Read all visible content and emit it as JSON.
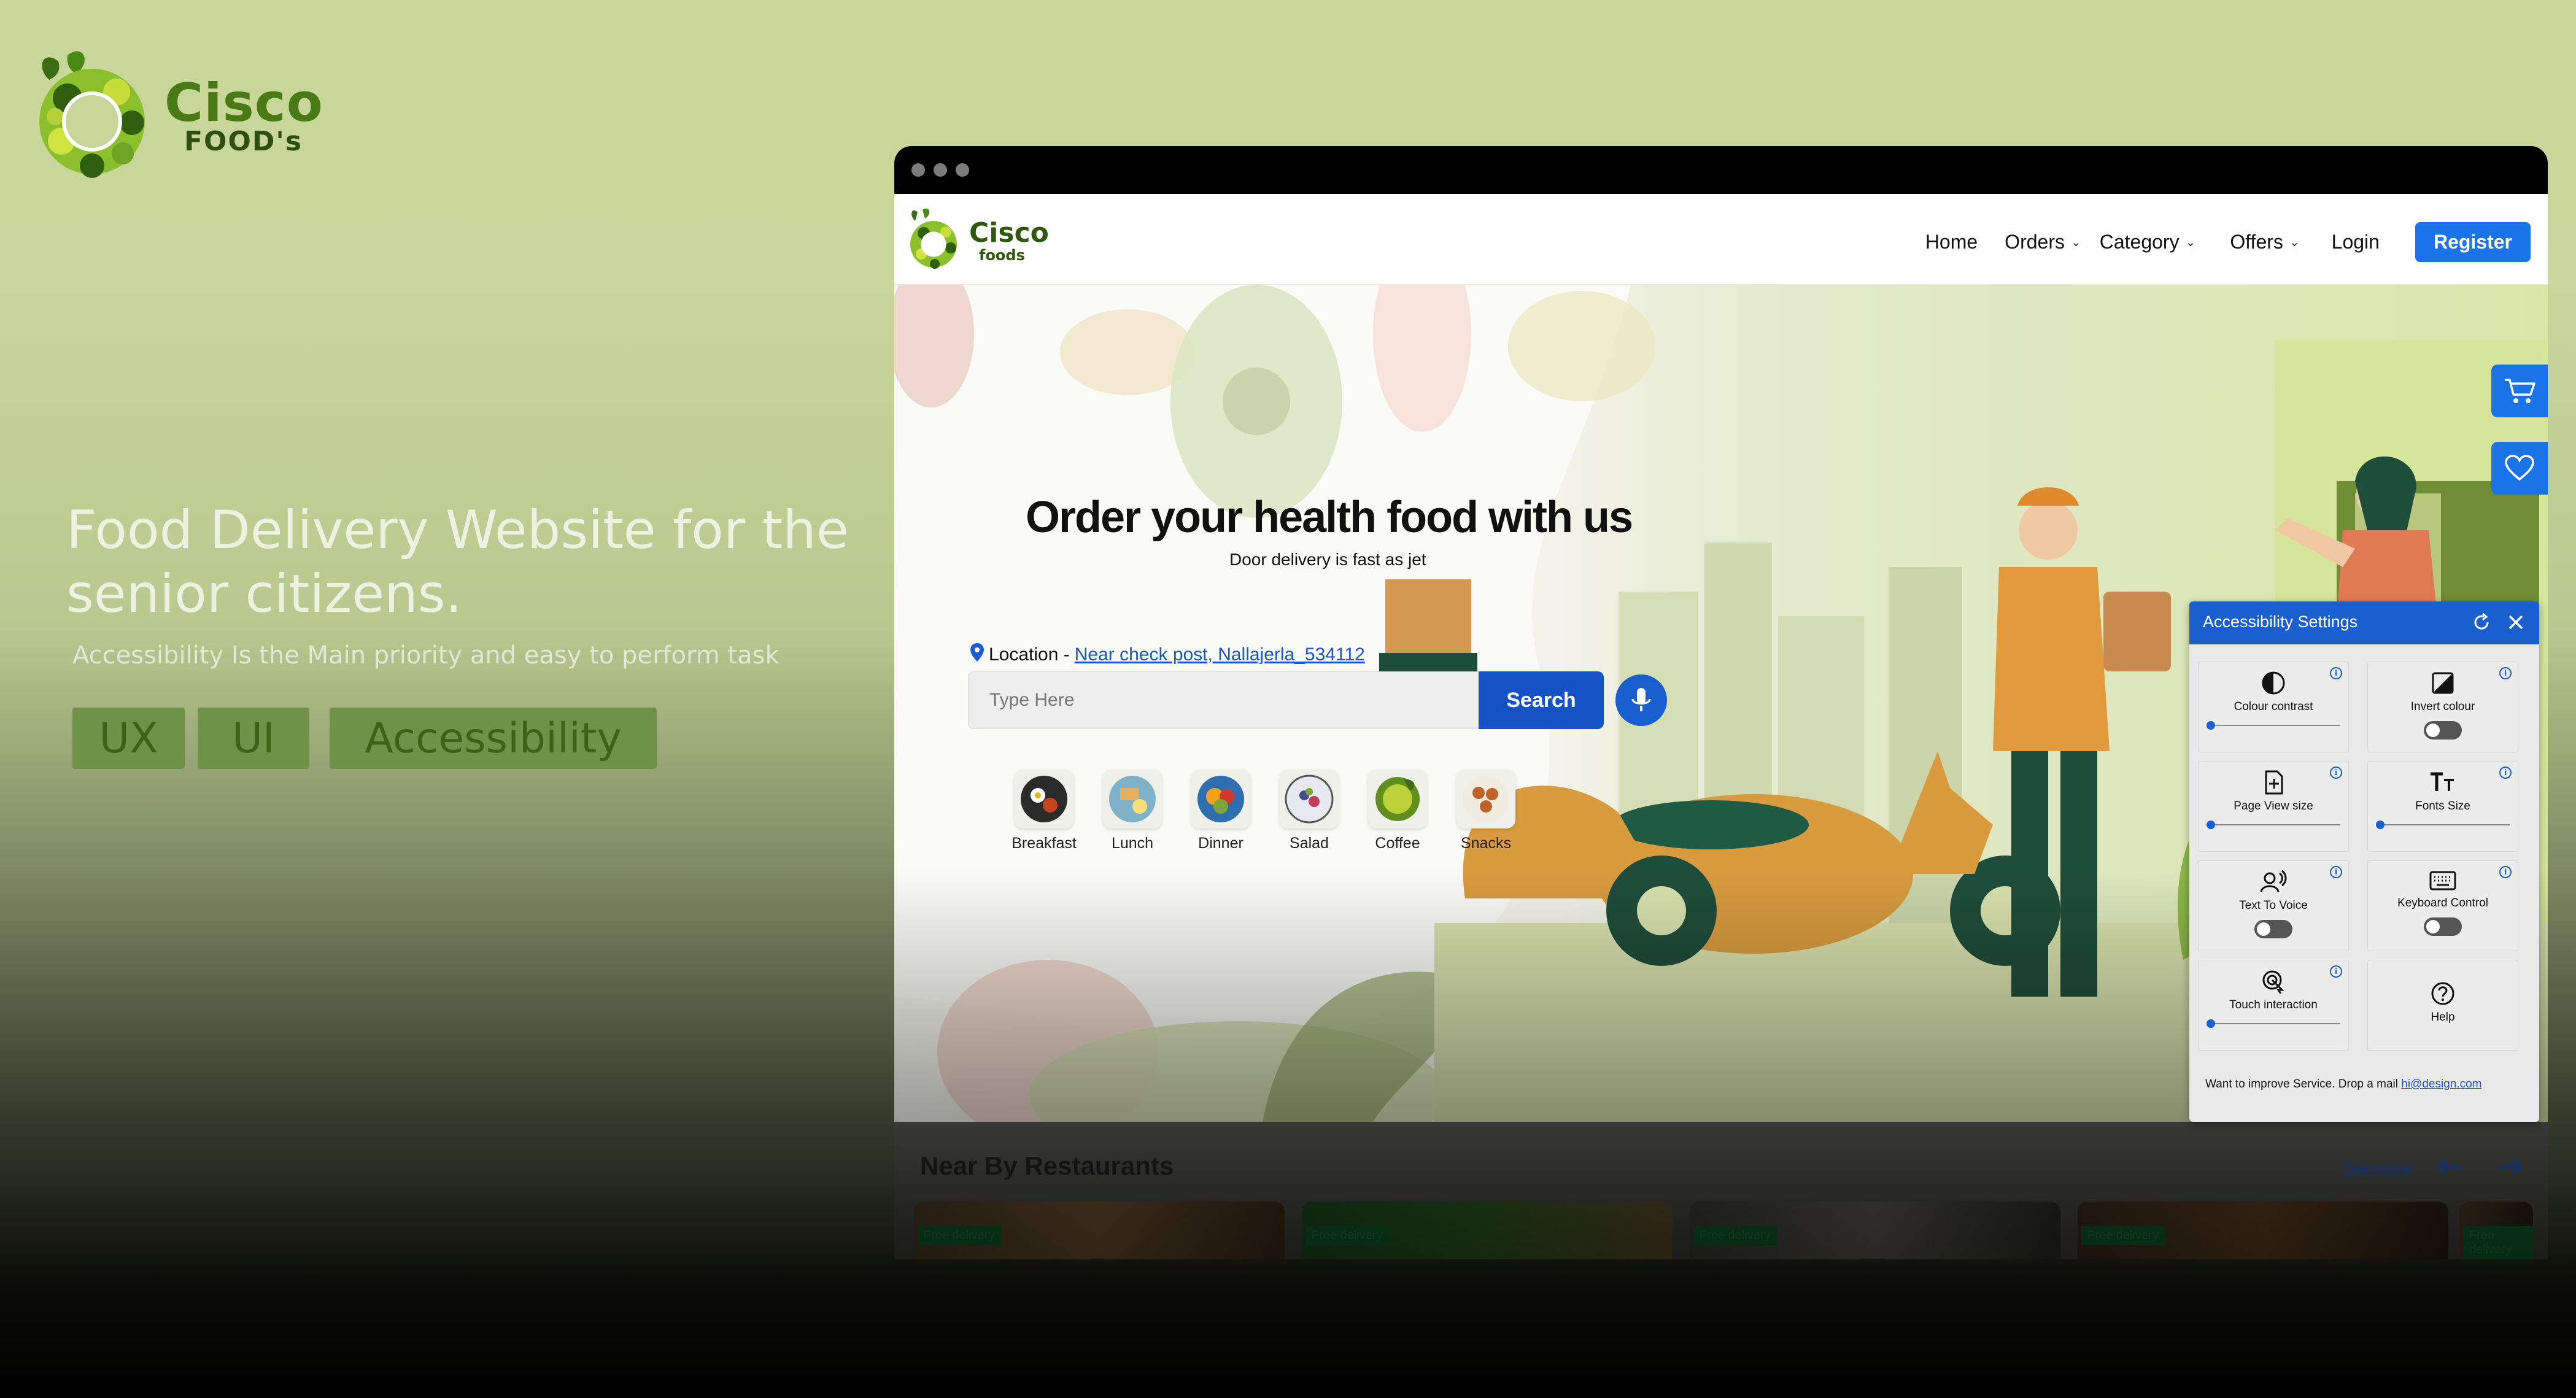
{
  "presentation": {
    "brand_name": "Cisco",
    "brand_sub": "FOOD's",
    "headline_line1": "Food Delivery Website for the",
    "headline_line2": "senior citizens.",
    "subline": "Accessibility Is the Main priority and easy to perform task",
    "tags": [
      "UX",
      "UI",
      "Accessibility"
    ]
  },
  "site": {
    "brand_name": "Cisco",
    "brand_sub": "foods",
    "nav": {
      "home": "Home",
      "orders": "Orders",
      "category": "Category",
      "offers": "Offers",
      "login": "Login",
      "register": "Register"
    },
    "hero": {
      "title": "Order your health food with us",
      "subtitle": "Door delivery is fast as jet",
      "location_label": "Location -",
      "location_value": "Near check post, Nallajerla_534112",
      "search_placeholder": "Type Here",
      "search_button": "Search",
      "categories": [
        "Breakfast",
        "Lunch",
        "Dinner",
        "Salad",
        "Coffee",
        "Snacks"
      ]
    },
    "near_by": {
      "title": "Near By Restaurants",
      "see_more": "See more",
      "card_badge": "Free delivery"
    }
  },
  "accessibility_panel": {
    "title": "Accessibility Settings",
    "tiles": {
      "colour_contrast": "Colour contrast",
      "invert_colour": "Invert colour",
      "page_view_size": "Page View size",
      "fonts_size": "Fonts Size",
      "text_to_voice": "Text To Voice",
      "keyboard_control": "Keyboard Control",
      "touch_interaction": "Touch interaction",
      "help": "Help"
    },
    "footer_text": "Want to improve Service. Drop a mail",
    "footer_link": "hi@design.com"
  },
  "colors": {
    "brand_green": "#4a7a16",
    "accent_blue": "#1a73e8",
    "search_blue": "#1553c4"
  }
}
